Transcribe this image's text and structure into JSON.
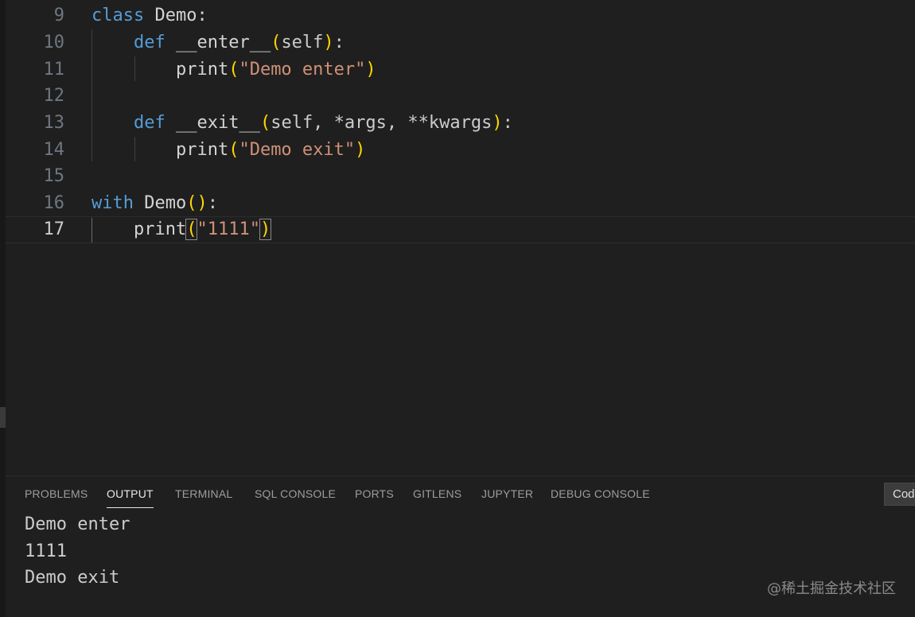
{
  "editor": {
    "lines": [
      {
        "num": "9"
      },
      {
        "num": "10"
      },
      {
        "num": "11"
      },
      {
        "num": "12"
      },
      {
        "num": "13"
      },
      {
        "num": "14"
      },
      {
        "num": "15"
      },
      {
        "num": "16"
      },
      {
        "num": "17"
      }
    ],
    "tokens": {
      "l9_kw": "class",
      "l9_rest": " Demo:",
      "l10_kw": "def",
      "l10_name": " __enter__",
      "l10_open": "(",
      "l10_arg": "self",
      "l10_close": ")",
      "l10_colon": ":",
      "l11_fn": "print",
      "l11_open": "(",
      "l11_str": "\"Demo enter\"",
      "l11_close": ")",
      "l13_kw": "def",
      "l13_name": " __exit__",
      "l13_open": "(",
      "l13_args": "self, *args, **kwargs",
      "l13_close": ")",
      "l13_colon": ":",
      "l14_fn": "print",
      "l14_open": "(",
      "l14_str": "\"Demo exit\"",
      "l14_close": ")",
      "l16_kw": "with",
      "l16_name": " Demo",
      "l16_open": "(",
      "l16_close": ")",
      "l16_colon": ":",
      "l17_fn": "print",
      "l17_open": "(",
      "l17_str": "\"1111\"",
      "l17_close": ")"
    },
    "current_line": "17"
  },
  "panel": {
    "tabs": [
      {
        "label": "PROBLEMS"
      },
      {
        "label": "OUTPUT",
        "active": true
      },
      {
        "label": "TERMINAL"
      },
      {
        "label": "SQL CONSOLE"
      },
      {
        "label": "PORTS"
      },
      {
        "label": "GITLENS"
      },
      {
        "label": "JUPYTER"
      },
      {
        "label": "DEBUG CONSOLE"
      }
    ],
    "output_channel_select": "Cod",
    "output_lines": [
      "Demo enter",
      "1111",
      "Demo exit"
    ]
  },
  "watermark": "@稀土掘金技术社区",
  "colors": {
    "background": "#1f1f1f",
    "keyword": "#569cd6",
    "string": "#ce9178",
    "bracket": "#ffd700",
    "text": "#cccccc"
  }
}
